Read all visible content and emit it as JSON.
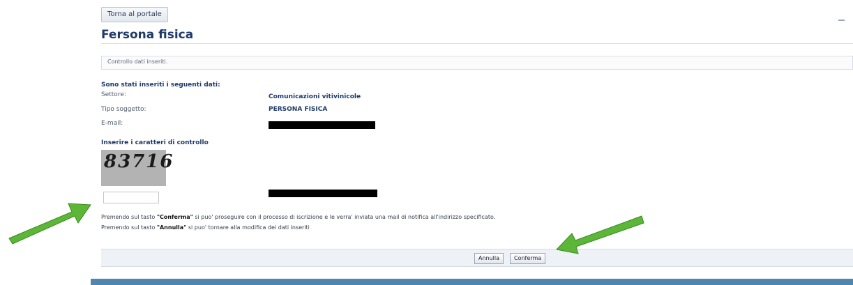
{
  "header": {
    "back_button": "Torna al portale",
    "page_title": "Fersona fisica"
  },
  "status": {
    "text": "Controllo dati inseriti."
  },
  "summary": {
    "section_title": "Sono stati inseriti i seguenti dati:",
    "rows": [
      {
        "label": "Settore:",
        "value": "Comunicazioni vitivinicole"
      },
      {
        "label": "Tipo soggetto:",
        "value": "PERSONA FISICA"
      },
      {
        "label": "E-mail:",
        "value": ""
      }
    ]
  },
  "captcha": {
    "heading": "Inserire i caratteri di controllo",
    "code": "83716",
    "input_value": ""
  },
  "info": {
    "line1_prefix": "Premendo sul tasto ",
    "line1_key": "\"Conferma\"",
    "line1_suffix": " si puo' proseguire con il processo di iscrizione e le verra' inviata una mail di notifica all'indirizzo specificato.",
    "line2_prefix": "Premendo sul tasto ",
    "line2_key": "\"Annulla\"",
    "line2_suffix": " si puo' tornare alla modifica dei dati inseriti"
  },
  "actions": {
    "cancel_label": "Annulla",
    "confirm_label": "Conferma"
  },
  "colors": {
    "title": "#1f3a68",
    "footer_band": "#4f86ad",
    "arrow": "#5cb637"
  }
}
